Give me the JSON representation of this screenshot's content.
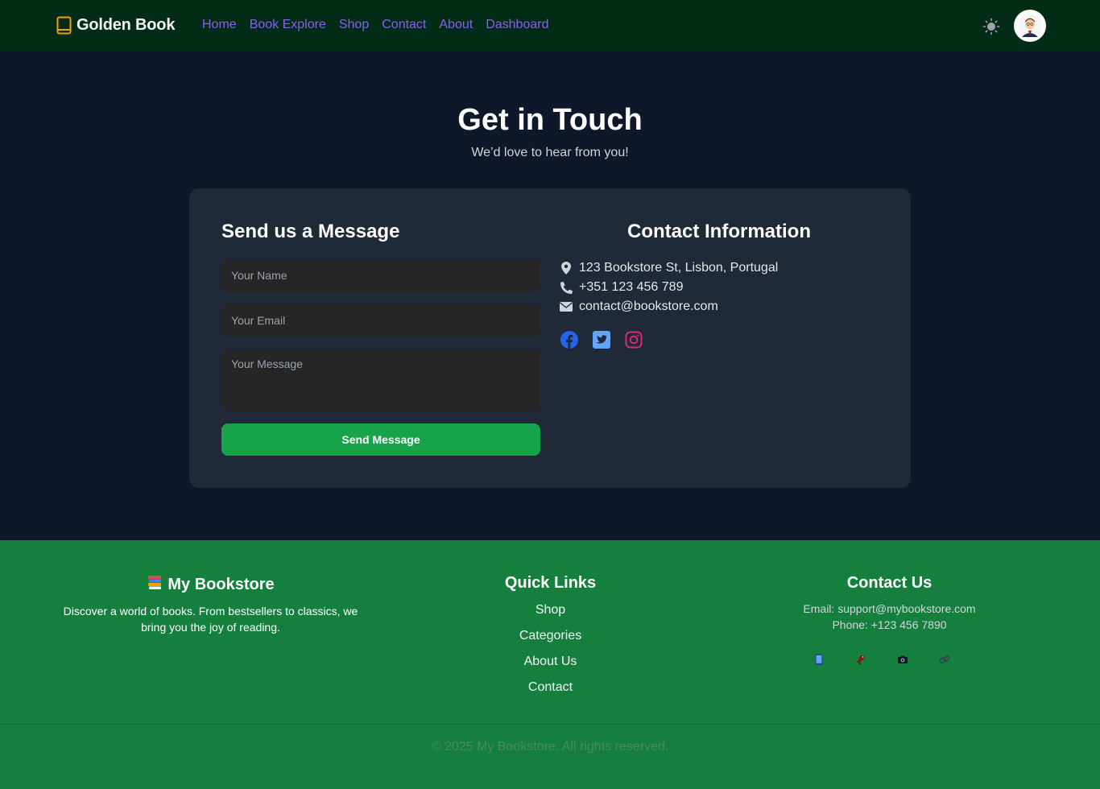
{
  "navbar": {
    "brand": "Golden Book",
    "links": [
      "Home",
      "Book Explore",
      "Shop",
      "Contact",
      "About",
      "Dashboard"
    ],
    "theme_icon": "sun-icon",
    "avatar_icon": "user-avatar"
  },
  "hero": {
    "title": "Get in Touch",
    "subtitle": "We’d love to hear from you!"
  },
  "form": {
    "title": "Send us a Message",
    "name_placeholder": "Your Name",
    "email_placeholder": "Your Email",
    "message_placeholder": "Your Message",
    "submit_label": "Send Message"
  },
  "contact_info": {
    "title": "Contact Information",
    "address": "123 Bookstore St, Lisbon, Portugal",
    "phone": "+351 123 456 789",
    "email": "contact@bookstore.com",
    "socials": [
      "facebook-icon",
      "twitter-icon",
      "instagram-icon"
    ]
  },
  "footer": {
    "brand_title": "My Bookstore",
    "brand_desc": "Discover a world of books. From bestsellers to classics, we bring you the joy of reading.",
    "quick_links_title": "Quick Links",
    "quick_links": [
      "Shop",
      "Categories",
      "About Us",
      "Contact"
    ],
    "contact_title": "Contact Us",
    "contact_email": "Email: support@mybookstore.com",
    "contact_phone": "Phone: +123 456 7890",
    "social_icons": [
      "tablet-icon",
      "bird-icon",
      "camera-icon",
      "link-icon"
    ],
    "copyright": "© 2025 My Bookstore. All rights reserved."
  },
  "colors": {
    "nav_bg": "#022c16",
    "page_bg": "#0f172a",
    "card_bg": "#1f2937",
    "accent_link": "#8b5cf6",
    "button": "#16a34a",
    "footer_bg": "#15803d"
  }
}
